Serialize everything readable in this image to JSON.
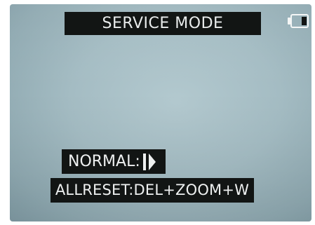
{
  "screen": {
    "title": "SERVICE MODE",
    "battery_icon": "battery-icon",
    "menu": {
      "normal_label": "NORMAL:",
      "normal_arrow_icon": "arrow-right-icon",
      "allreset_label": "ALLRESET:DEL+ZOOM+W"
    }
  }
}
